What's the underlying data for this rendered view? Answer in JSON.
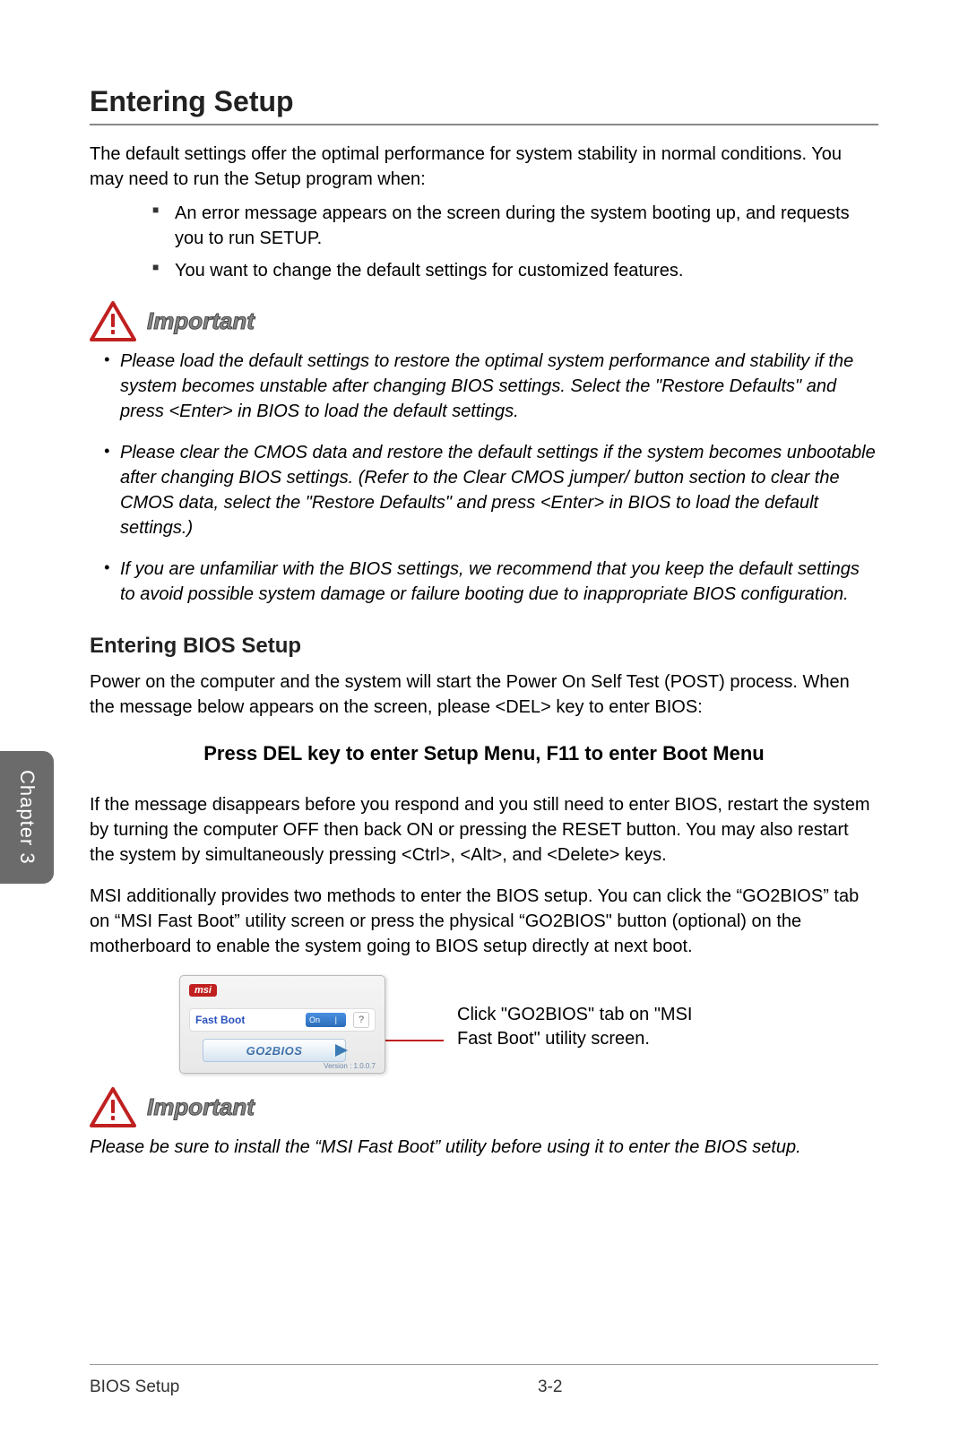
{
  "chapter_tab": "Chapter 3",
  "main_title": "Entering Setup",
  "intro": "The default settings offer the optimal performance for system stability in normal conditions. You may need to run the Setup program when:",
  "intro_bullets": [
    "An error message appears on the screen during the system booting up, and requests you to run SETUP.",
    "You want to change the default settings for customized features."
  ],
  "important_label": "Important",
  "important1_items": [
    "Please load the default settings to restore the optimal system performance and stability if the system becomes unstable after changing BIOS settings. Select the \"Restore Defaults\" and press <Enter> in BIOS to load the default settings.",
    "Please clear the CMOS data and restore the default settings if the system becomes unbootable after changing BIOS settings. (Refer to the Clear CMOS jumper/ button section to clear the CMOS data, select the \"Restore Defaults\" and press <Enter> in BIOS to load the default settings.)",
    "If you are unfamiliar with the BIOS settings, we recommend that you keep the default settings to avoid possible system damage or failure booting due to inappropriate BIOS configuration."
  ],
  "sub_heading": "Entering BIOS Setup",
  "sub_para1": "Power on the computer and the system will start the Power On Self Test (POST) process. When the message below appears on the screen, please <DEL> key to enter BIOS:",
  "center_bold": "Press DEL key to enter Setup Menu, F11 to enter Boot Menu",
  "sub_para2": "If the message disappears before you respond and you still need to enter BIOS, restart the system by turning the computer OFF then back ON or pressing the RESET button. You may also restart the system by simultaneously pressing <Ctrl>, <Alt>, and <Delete> keys.",
  "sub_para3": "MSI additionally provides two methods to enter the BIOS setup. You can click the “GO2BIOS” tab on “MSI Fast Boot” utility screen or press the physical “GO2BIOS\" button (optional) on the motherboard to enable the system going to BIOS setup directly at next boot.",
  "utility": {
    "brand": "msi",
    "fastboot_label": "Fast Boot",
    "toggle_state": "On",
    "help": "?",
    "go2bios": "GO2BIOS",
    "version": "Version : 1.0.0.7"
  },
  "callout": "Click \"GO2BIOS\" tab on \"MSI Fast Boot\" utility screen.",
  "important2_text": "Please be sure to install the “MSI Fast Boot” utility before using it to enter the BIOS setup.",
  "footer": {
    "left": "BIOS Setup",
    "center": "3-2"
  }
}
